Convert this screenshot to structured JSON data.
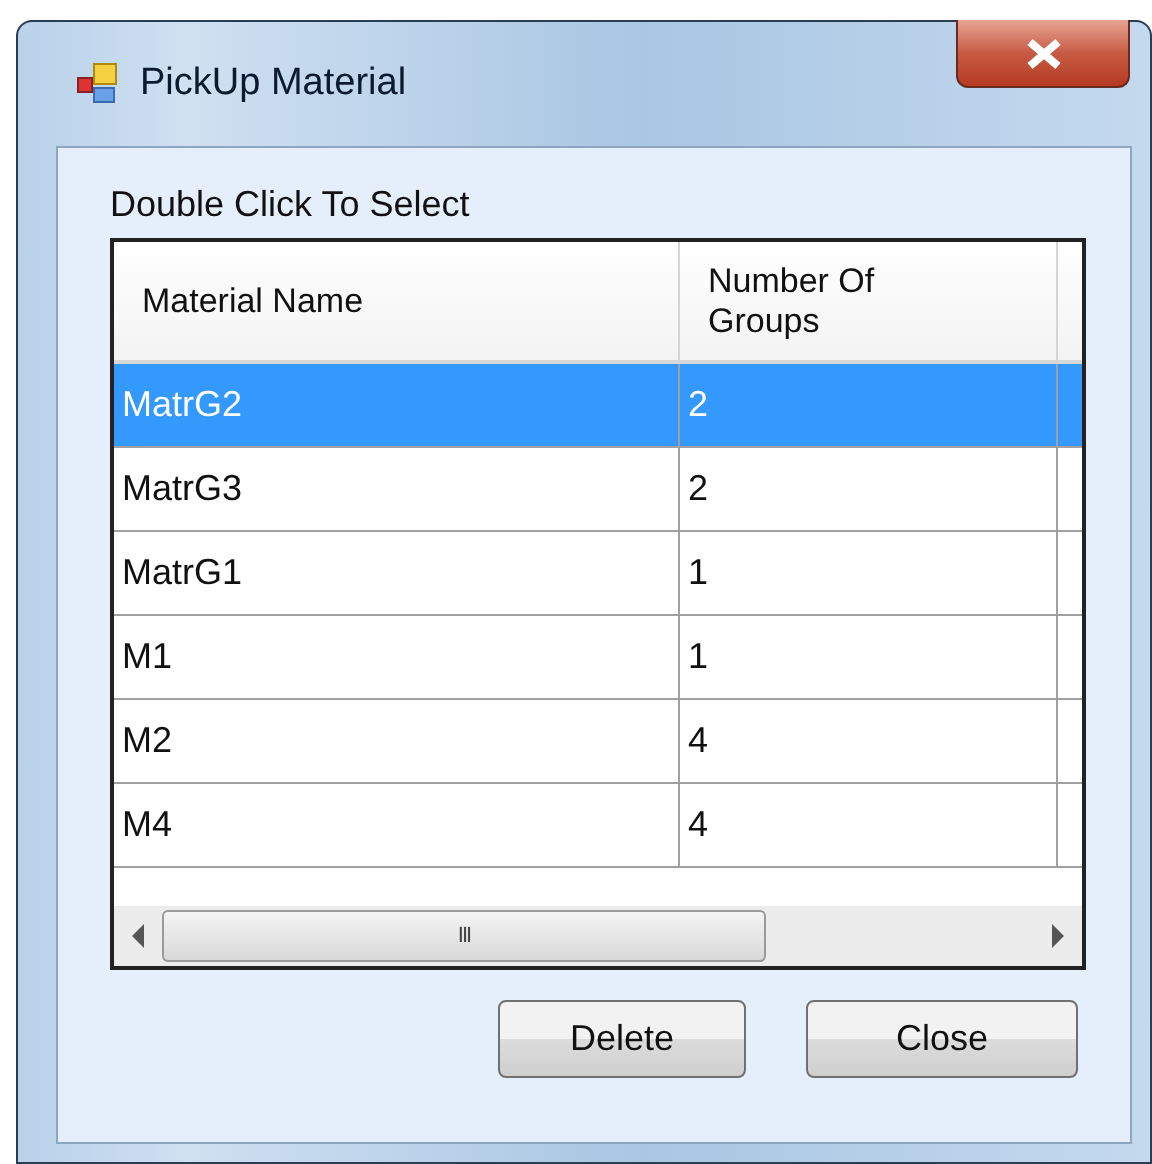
{
  "window": {
    "title": "PickUp Material"
  },
  "caption": "Double Click To Select",
  "table": {
    "columns": [
      "Material Name",
      "Number Of Groups"
    ],
    "rows": [
      {
        "cells": [
          "MatrG2",
          "2"
        ],
        "selected": true
      },
      {
        "cells": [
          "MatrG3",
          "2"
        ],
        "selected": false
      },
      {
        "cells": [
          "MatrG1",
          "1"
        ],
        "selected": false
      },
      {
        "cells": [
          "M1",
          "1"
        ],
        "selected": false
      },
      {
        "cells": [
          "M2",
          "4"
        ],
        "selected": false
      },
      {
        "cells": [
          "M4",
          "4"
        ],
        "selected": false
      }
    ]
  },
  "scrollbar_glyph": "III",
  "buttons": [
    "Delete",
    "Close"
  ]
}
